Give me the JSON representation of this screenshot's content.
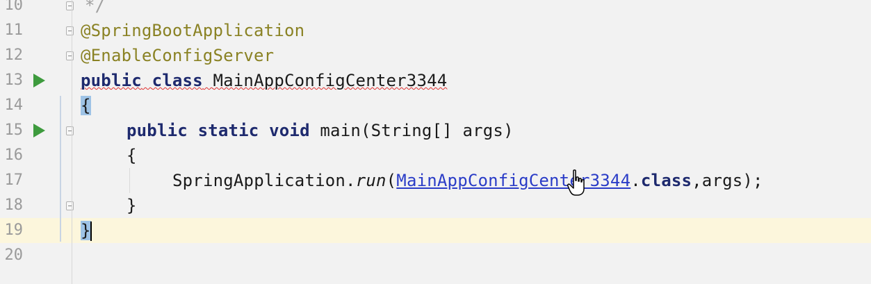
{
  "editor": {
    "lines": [
      {
        "number": "10",
        "code": "*/"
      },
      {
        "number": "11",
        "code": "@SpringBootApplication"
      },
      {
        "number": "12",
        "code": "@EnableConfigServer"
      },
      {
        "number": "13",
        "kw1": "public",
        "kw2": "class",
        "name": "MainAppConfigCenter3344"
      },
      {
        "number": "14",
        "code": "{"
      },
      {
        "number": "15",
        "kw1": "public",
        "kw2": "static",
        "kw3": "void",
        "rest": "main(String[] args)"
      },
      {
        "number": "16",
        "code": "{"
      },
      {
        "number": "17",
        "prefix": "SpringApplication.",
        "method": "run",
        "open": "(",
        "link": "MainAppConfigCenter3344",
        "dot": ".",
        "kw": "class",
        "tail": ",args);"
      },
      {
        "number": "18",
        "code": "}"
      },
      {
        "number": "19",
        "code": "}"
      },
      {
        "number": "20",
        "code": ""
      }
    ]
  },
  "colors": {
    "annotation": "#8a8224",
    "keyword": "#1e2a6e",
    "link": "#2a3cc7",
    "current_line": "#fcf6dc",
    "brace_highlight": "#9ec3e6",
    "run_icon": "#3e9b3e"
  },
  "icons": {
    "run": "run-icon",
    "fold": "fold-icon",
    "cursor": "hand-pointer-icon"
  }
}
